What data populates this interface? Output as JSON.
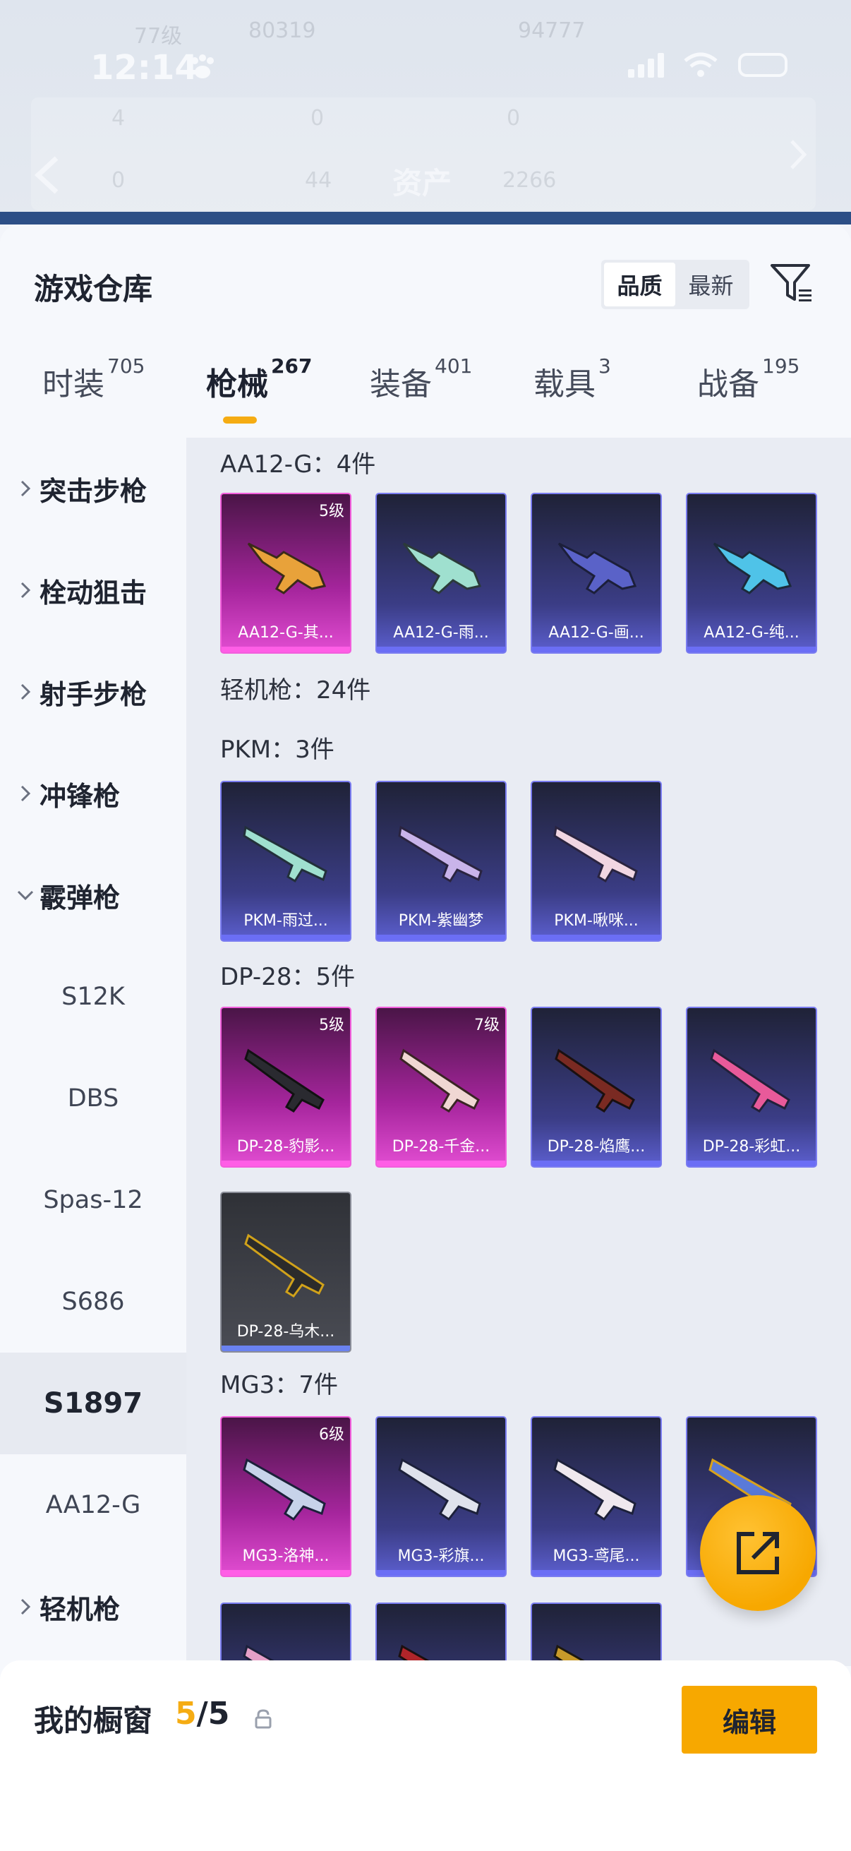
{
  "colors": {
    "accent": "#f7a800",
    "rarity_pink": "#d83cc6",
    "rarity_purple": "#5c5fcf",
    "rarity_gray": "#4a4c54"
  },
  "status_bar": {
    "time": "12:14"
  },
  "header": {
    "title": "资产",
    "faint_stats": [
      "77级",
      "80319",
      "94777",
      "0",
      "0",
      "0",
      "4",
      "0",
      "44",
      "2266"
    ]
  },
  "sheet": {
    "title": "游戏仓库",
    "sort_options": [
      {
        "label": "品质",
        "active": true
      },
      {
        "label": "最新",
        "active": false
      }
    ],
    "tabs": [
      {
        "label": "时装",
        "count": "705"
      },
      {
        "label": "枪械",
        "count": "267",
        "active": true
      },
      {
        "label": "装备",
        "count": "401"
      },
      {
        "label": "载具",
        "count": "3"
      },
      {
        "label": "战备",
        "count": "195"
      }
    ]
  },
  "sidebar": {
    "categories": [
      "突击步枪",
      "栓动狙击",
      "射手步枪",
      "冲锋枪",
      "霰弹枪"
    ],
    "subitems": [
      "S12K",
      "DBS",
      "Spas-12",
      "S686",
      "S1897",
      "AA12-G"
    ],
    "active_sub": "S1897",
    "last_category": "轻机枪"
  },
  "sections": {
    "aa12": {
      "title": "AA12-G：4件",
      "items": [
        {
          "name": "AA12-G-其...",
          "level": "5级",
          "rarity": "pink"
        },
        {
          "name": "AA12-G-雨...",
          "rarity": "purple"
        },
        {
          "name": "AA12-G-画...",
          "rarity": "purple"
        },
        {
          "name": "AA12-G-纯...",
          "rarity": "purple"
        }
      ]
    },
    "lmg_title": "轻机枪：24件",
    "pkm": {
      "title": "PKM：3件",
      "items": [
        {
          "name": "PKM-雨过...",
          "rarity": "purple"
        },
        {
          "name": "PKM-紫幽梦",
          "rarity": "purple"
        },
        {
          "name": "PKM-啾咪...",
          "rarity": "purple"
        }
      ]
    },
    "dp28": {
      "title": "DP-28：5件",
      "items": [
        {
          "name": "DP-28-豹影...",
          "level": "5级",
          "rarity": "pink"
        },
        {
          "name": "DP-28-千金...",
          "level": "7级",
          "rarity": "pink"
        },
        {
          "name": "DP-28-焰鹰...",
          "rarity": "purple"
        },
        {
          "name": "DP-28-彩虹...",
          "rarity": "purple"
        },
        {
          "name": "DP-28-乌木...",
          "rarity": "gray"
        }
      ]
    },
    "mg3": {
      "title": "MG3：7件",
      "items": [
        {
          "name": "MG3-洛神...",
          "level": "6级",
          "rarity": "pink"
        },
        {
          "name": "MG3-彩旗...",
          "rarity": "purple"
        },
        {
          "name": "MG3-鸢尾...",
          "rarity": "purple"
        },
        {
          "name": "",
          "rarity": "purple"
        }
      ]
    }
  },
  "showcase": {
    "label": "我的橱窗",
    "current": "5",
    "separator": "/",
    "total": "5",
    "edit_label": "编辑"
  }
}
